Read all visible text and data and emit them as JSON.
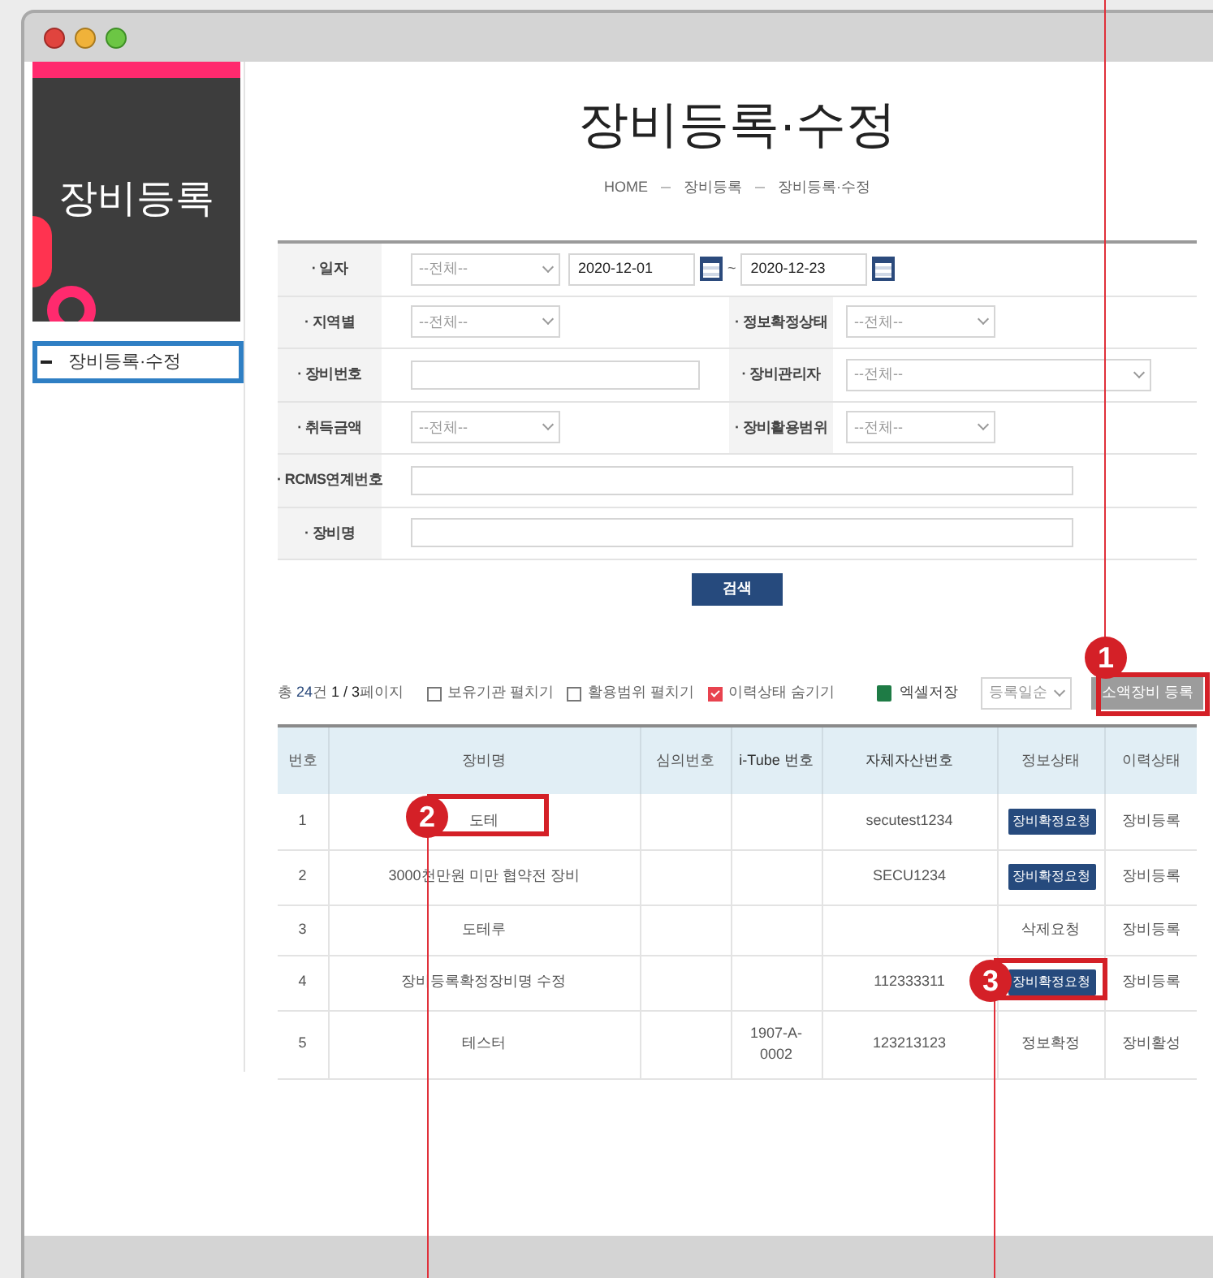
{
  "sidebar": {
    "banner_title": "장비등록",
    "items": [
      {
        "label": "장비등록·수정",
        "selected": true
      }
    ]
  },
  "page": {
    "title": "장비등록·수정",
    "breadcrumb": [
      "HOME",
      "장비등록",
      "장비등록·수정"
    ]
  },
  "search_form": {
    "rows": [
      {
        "fields": [
          {
            "label": "· 일자",
            "kind": "date_range",
            "select": "--전체--",
            "from": "2020-12-01",
            "separator": "~",
            "to": "2020-12-23"
          }
        ]
      },
      {
        "fields": [
          {
            "label": "· 지역별",
            "kind": "select",
            "value": "--전체--"
          },
          {
            "label": "· 정보확정상태",
            "kind": "select",
            "value": "--전체--"
          }
        ]
      },
      {
        "fields": [
          {
            "label": "· 장비번호",
            "kind": "text"
          },
          {
            "label": "· 장비관리자",
            "kind": "wide_select",
            "value": "--전체--"
          }
        ]
      },
      {
        "fields": [
          {
            "label": "· 취득금액",
            "kind": "select",
            "value": "--전체--"
          },
          {
            "label": "· 장비활용범위",
            "kind": "select",
            "value": "--전체--"
          }
        ]
      },
      {
        "fields": [
          {
            "label": "· RCMS연계번호",
            "kind": "long_text"
          }
        ]
      },
      {
        "fields": [
          {
            "label": "· 장비명",
            "kind": "long_text"
          }
        ]
      }
    ],
    "search_button": "검색"
  },
  "toolbar": {
    "count_prefix": "총",
    "count": "24",
    "count_suffix": "건",
    "page": "1 / 3",
    "page_suffix": "페이지",
    "toggles": [
      {
        "label": "보유기관 펼치기",
        "checked": false
      },
      {
        "label": "활용범위 펼치기",
        "checked": false
      },
      {
        "label": "이력상태 숨기기",
        "checked": true
      }
    ],
    "excel": "엑셀저장",
    "sort": "등록일순",
    "register_button": "소액장비 등록"
  },
  "table": {
    "columns": [
      "번호",
      "장비명",
      "심의번호",
      "i-Tube 번호",
      "자체자산번호",
      "정보상태",
      "이력상태"
    ],
    "rows": [
      {
        "cells": [
          "1",
          "도테",
          "",
          "",
          "secutest1234",
          "장비확정요청",
          "장비등록"
        ],
        "kind": "button"
      },
      {
        "cells": [
          "2",
          "3000천만원 미만 협약전 장비",
          "",
          "",
          "SECU1234",
          "장비확정요청",
          "장비등록"
        ],
        "kind": "button"
      },
      {
        "cells": [
          "3",
          "도테루",
          "",
          "",
          "",
          "삭제요청",
          "장비등록"
        ],
        "kind": "text"
      },
      {
        "cells": [
          "4",
          "장비등록확정장비명 수정",
          "",
          "",
          "112333311",
          "장비확정요청",
          "장비등록"
        ],
        "kind": "button"
      },
      {
        "cells": [
          "5",
          "테스터",
          "",
          "1907-A-0002",
          "123213123",
          "정보확정",
          "장비활성"
        ],
        "kind": "text"
      }
    ]
  },
  "annotations": [
    {
      "number": "1"
    },
    {
      "number": "2"
    },
    {
      "number": "3"
    }
  ]
}
